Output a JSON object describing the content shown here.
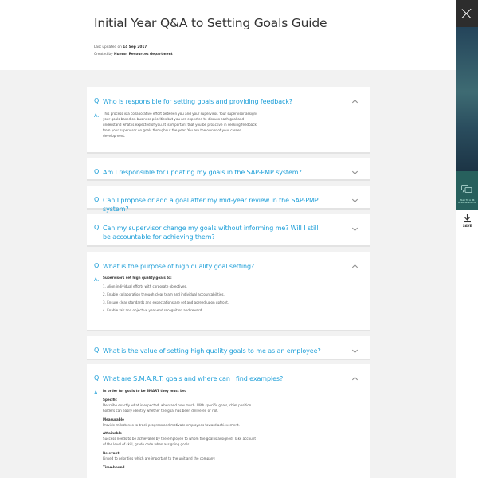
{
  "doc": {
    "title": "Initial Year Q&A to Setting Goals Guide",
    "meta_updated_label": "Last updated on",
    "meta_updated_value": "14 Sep 2017",
    "meta_created_label": "Created by",
    "meta_created_value": "Human Resources department"
  },
  "faq": {
    "q_mark": "Q.",
    "a_mark": "A.",
    "items": [
      {
        "question": "Who is responsible for setting goals and providing feedback?",
        "answer": "This process is a collaborative effort between you and your supervisor. Your supervisor assigns your goals based on business priorities but you are expected to discuss each goal and understand what is expected of you. It is important that you be proactive in seeking feedback from your supervisor on goals throughout the year. You are the owner of your career development."
      },
      {
        "question": "Am I responsible for updating my goals in the SAP-PMP system?"
      },
      {
        "question": "Can I propose or add a goal after my mid-year review in the SAP-PMP system?"
      },
      {
        "question": "Can my supervisor change my goals without informing me? Will I still be accountable for achieving them?"
      },
      {
        "question": "What is the purpose of high quality goal setting?",
        "answer_lead": "Supervisors set high quality goals to:",
        "answer_items": [
          "1. Align individual efforts with corporate objectives.",
          "2. Enable collaboration through clear team and individual accountabilities.",
          "3. Ensure clear standards and expectations are set and agreed upon upfront.",
          "4. Enable fair and objective year-end recognition and reward."
        ]
      },
      {
        "question": "What is the value of setting high quality goals to me as an employee?"
      },
      {
        "question": "What are S.M.A.R.T. goals and where can I find examples?",
        "answer_lead": "In order for goals to be SMART they must be:",
        "sections": [
          {
            "heading": "Specific",
            "text": "Describe exactly what is expected, when and how much. With specific goals, chief position holders can easily identify whether the goal has been delivered or not."
          },
          {
            "heading": "Measurable",
            "text": "Provide milestones to track progress and motivate employees toward achievement."
          },
          {
            "heading": "Attainable",
            "text": "Success needs to be achievable by the employee to whom the goal is assigned. Take account of the level of skill, grade code when assigning goals."
          },
          {
            "heading": "Relevant",
            "text": "Linked to priorities which are important to the unit and the company."
          },
          {
            "heading": "Time-bound",
            "text": ""
          }
        ]
      }
    ]
  },
  "sidebar": {
    "chat_label": "TALK TO A HR REPRESENTATIVE",
    "save_label": "SAVE"
  }
}
